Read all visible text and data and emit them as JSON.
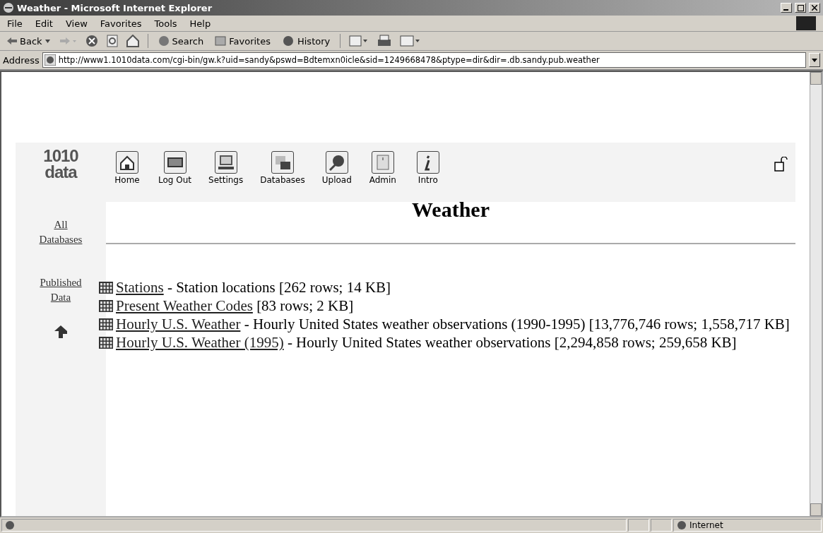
{
  "window": {
    "title": "Weather - Microsoft Internet Explorer"
  },
  "menu": [
    "File",
    "Edit",
    "View",
    "Favorites",
    "Tools",
    "Help"
  ],
  "toolbar": {
    "back": "Back",
    "search": "Search",
    "favorites": "Favorites",
    "history": "History"
  },
  "address": {
    "label": "Address",
    "value": "http://www1.1010data.com/cgi-bin/gw.k?uid=sandy&pswd=Bdtemxn0icle&sid=1249668478&ptype=dir&dir=.db.sandy.pub.weather"
  },
  "logo": [
    "1010",
    "data"
  ],
  "nav": [
    {
      "label": "Home",
      "kind": "home"
    },
    {
      "label": "Log Out",
      "kind": "exit"
    },
    {
      "label": "Settings",
      "kind": "settings"
    },
    {
      "label": "Databases",
      "kind": "databases"
    },
    {
      "label": "Upload",
      "kind": "upload"
    },
    {
      "label": "Admin",
      "kind": "admin"
    },
    {
      "label": "Intro",
      "kind": "intro"
    }
  ],
  "sidebar": {
    "links": [
      "All Databases",
      "Published Data"
    ]
  },
  "heading": "Weather",
  "tables": [
    {
      "link": "Stations",
      "text": " - Station locations [262 rows; 14 KB]"
    },
    {
      "link": "Present Weather Codes",
      "text": " [83 rows; 2 KB]"
    },
    {
      "link": "Hourly U.S. Weather",
      "text": " - Hourly United States weather observations (1990-1995) [13,776,746 rows; 1,558,717 KB]"
    },
    {
      "link": "Hourly U.S. Weather (1995)",
      "text": " - Hourly United States weather observations [2,294,858 rows; 259,658 KB]"
    }
  ],
  "status_bar": {
    "zone": "Internet"
  }
}
